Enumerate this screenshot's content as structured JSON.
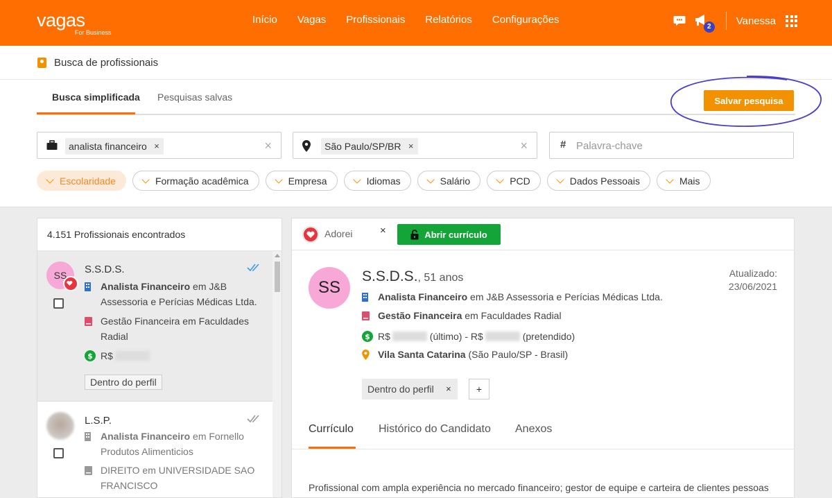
{
  "app": {
    "logo": "vagas",
    "logo_sub": "For Business",
    "nav": [
      "Início",
      "Vagas",
      "Profissionais",
      "Relatórios",
      "Configurações"
    ],
    "notification_count": "2",
    "user": "Vanessa",
    "accent_color": "#ff6e00"
  },
  "page": {
    "title": "Busca de profissionais",
    "tabs": [
      "Busca simplificada",
      "Pesquisas salvas"
    ],
    "save_button": "Salvar pesquisa"
  },
  "search": {
    "job_chip": "analista financeiro",
    "location_chip": "São Paulo/SP/BR",
    "keyword_placeholder": "Palavra-chave",
    "chip_remove": "×",
    "clear": "×"
  },
  "filters": [
    "Escolaridade",
    "Formação acadêmica",
    "Empresa",
    "Idiomas",
    "Salário",
    "PCD",
    "Dados Pessoais",
    "Mais"
  ],
  "results": {
    "count": "4.151 Profissionais encontrados",
    "items": [
      {
        "initials": "SS",
        "name": "S.S.D.S.",
        "role_bold": "Analista Financeiro",
        "role_rest": " em J&B Assessoria e Perícias Médicas Ltda.",
        "education": "Gestão Financeira em Faculdades Radial",
        "salary_prefix": "R$",
        "tag": "Dentro do perfil"
      },
      {
        "name": "L.S.P.",
        "role_bold": "Analista Financeiro",
        "role_rest": " em Fornello Produtos Alimenticios",
        "education": "DIREITO em UNIVERSIDADE SAO FRANCISCO"
      }
    ]
  },
  "detail": {
    "liked_label": "Adorei",
    "close": "×",
    "open_button": "Abrir currículo",
    "initials": "SS",
    "name": "S.S.D.S.",
    "age": ", 51 anos",
    "updated_label": "Atualizado:",
    "updated_date": "23/06/2021",
    "job_bold": "Analista Financeiro",
    "job_rest": " em J&B Assessoria e Perícias Médicas Ltda.",
    "edu_bold": "Gestão Financeira",
    "edu_rest": " em Faculdades Radial",
    "salary_prefix": "R$",
    "salary_last": "(último) - R$",
    "salary_expected": "(pretendido)",
    "location_bold": "Vila Santa Catarina",
    "location_rest": " (São Paulo/SP - Brasil)",
    "tag": "Dentro do perfil",
    "add_tag": "+",
    "tabs": [
      "Currículo",
      "Histórico do Candidato",
      "Anexos"
    ],
    "summary": "Profissional com ampla experiência no mercado financeiro; gestor de equipe e carteira de clientes pessoas"
  }
}
